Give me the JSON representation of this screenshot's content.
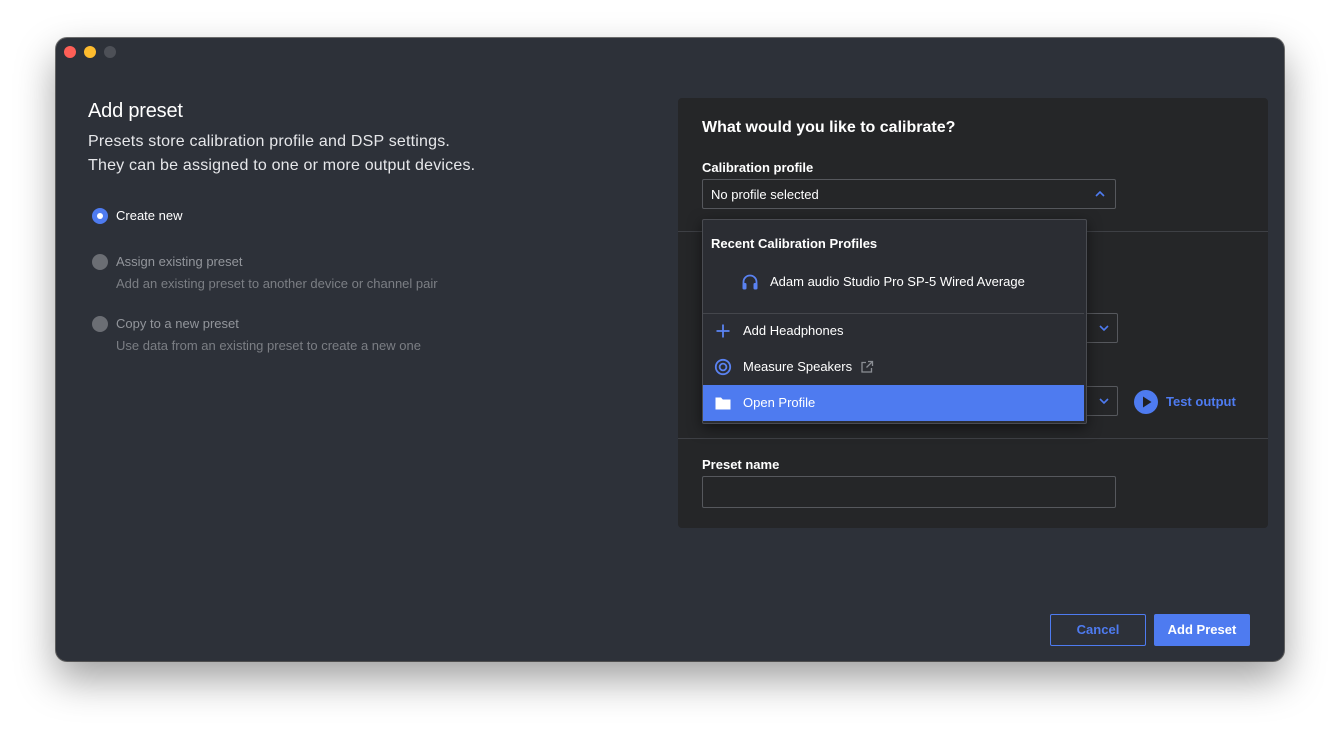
{
  "left": {
    "title": "Add preset",
    "description_line1": "Presets store calibration profile and DSP settings.",
    "description_line2": "They can be assigned to one or more output devices.",
    "options": [
      {
        "label": "Create new",
        "sublabel": "",
        "selected": true
      },
      {
        "label": "Assign existing preset",
        "sublabel": "Add an existing preset to another device or channel pair",
        "selected": false
      },
      {
        "label": "Copy to a new preset",
        "sublabel": "Use data from an existing preset to create a new one",
        "selected": false
      }
    ]
  },
  "panel": {
    "title": "What would you like to calibrate?",
    "calibration_profile_label": "Calibration profile",
    "calibration_profile_value": "No profile selected",
    "test_output_label": "Test output",
    "preset_name_label": "Preset name",
    "preset_name_value": ""
  },
  "dropdown": {
    "heading": "Recent Calibration Profiles",
    "recent": [
      {
        "label": "Adam audio Studio Pro SP-5 Wired Average",
        "icon": "headphones-icon"
      }
    ],
    "actions": [
      {
        "label": "Add Headphones",
        "icon": "plus-icon"
      },
      {
        "label": "Measure Speakers",
        "icon": "target-icon",
        "trailing_icon": "external-link-icon"
      },
      {
        "label": "Open Profile",
        "icon": "folder-icon",
        "selected": true
      }
    ]
  },
  "footer": {
    "cancel_label": "Cancel",
    "add_label": "Add Preset"
  },
  "colors": {
    "window_bg": "#2d3139",
    "panel_bg": "#252628",
    "accent": "#4e7bf0"
  }
}
